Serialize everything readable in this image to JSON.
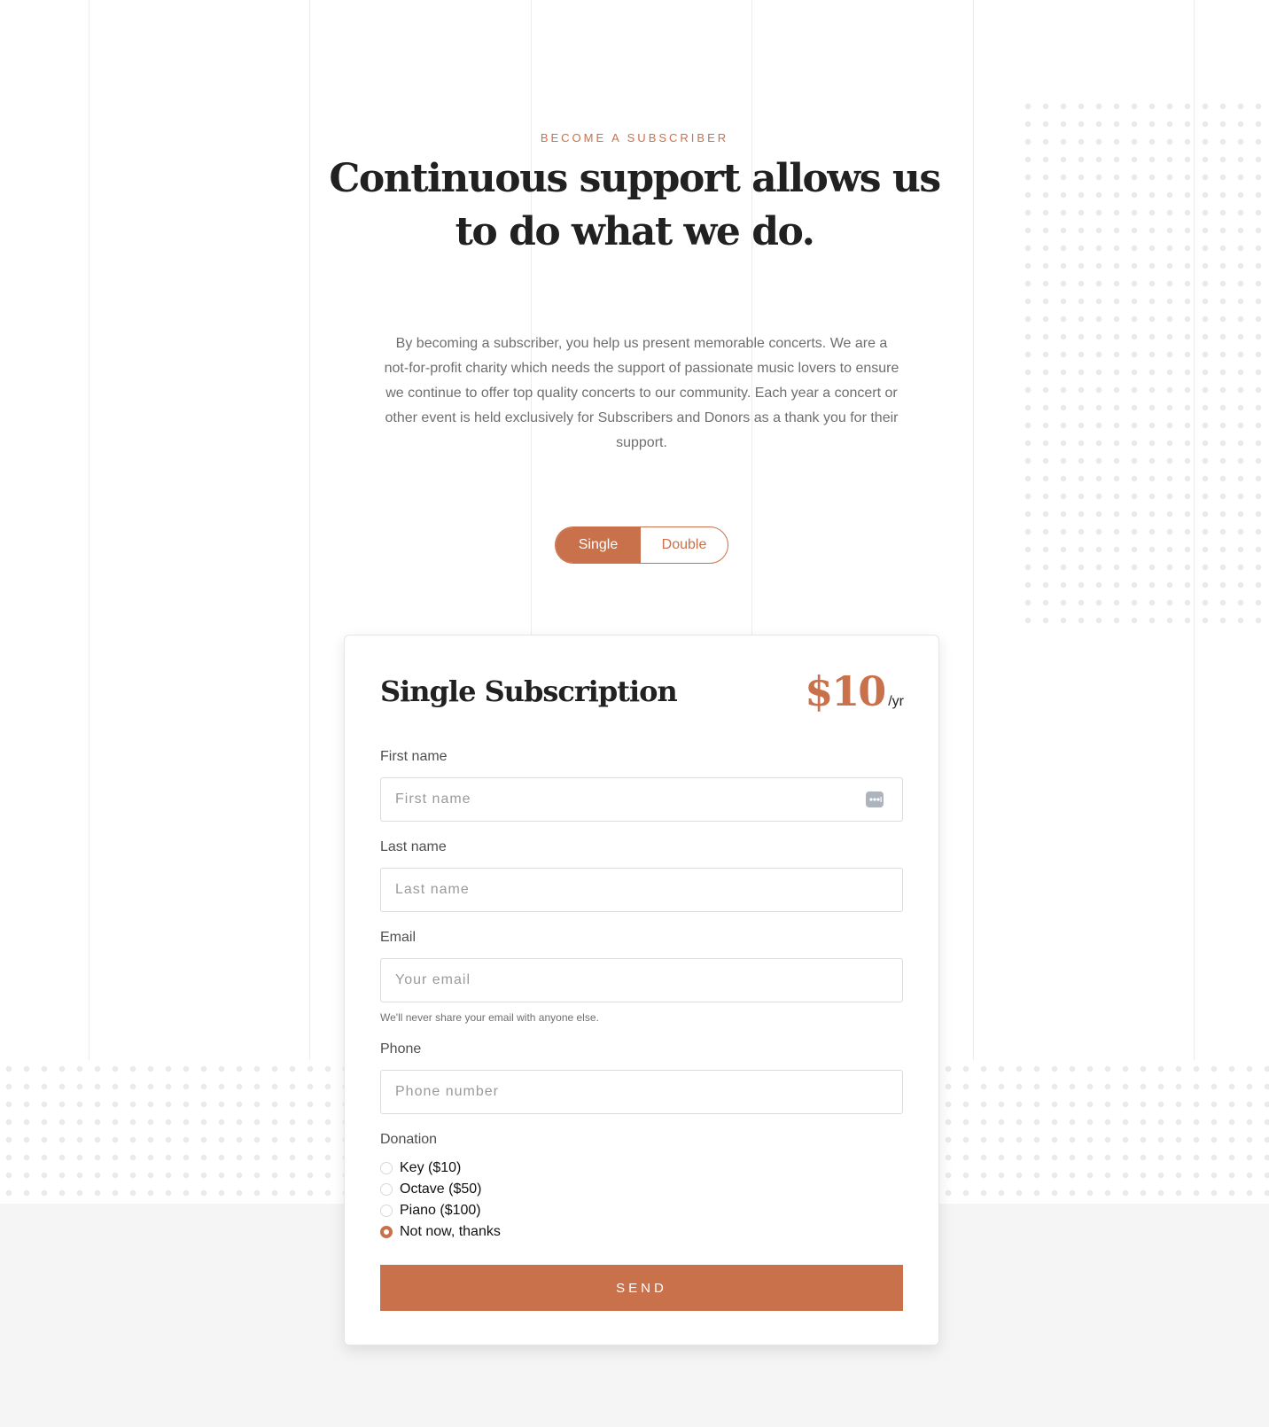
{
  "eyebrow": "BECOME A SUBSCRIBER",
  "headline": "Continuous support allows us to do what we do.",
  "intro": "By becoming a subscriber, you help us present memorable concerts. We are a not-for-profit charity which needs the support of passionate music lovers to ensure we continue to offer top quality concerts to our community. Each year a concert or other event is held exclusively for Subscribers and Donors as a thank you for their support.",
  "toggle": {
    "options": [
      "Single",
      "Double"
    ],
    "selected": "Single"
  },
  "card": {
    "title": "Single Subscription",
    "price": "$10",
    "period": "/yr"
  },
  "form": {
    "first_name": {
      "label": "First name",
      "placeholder": "First name",
      "value": ""
    },
    "last_name": {
      "label": "Last name",
      "placeholder": "Last name",
      "value": ""
    },
    "email": {
      "label": "Email",
      "placeholder": "Your email",
      "value": "",
      "help": "We'll never share your email with anyone else."
    },
    "phone": {
      "label": "Phone",
      "placeholder": "Phone number",
      "value": ""
    },
    "donation": {
      "label": "Donation",
      "options": [
        "Key ($10)",
        "Octave ($50)",
        "Piano ($100)",
        "Not now, thanks"
      ],
      "selected": "Not now, thanks"
    },
    "submit_label": "SEND"
  },
  "icons": {
    "autofill": "autofill-key-icon"
  },
  "colors": {
    "accent": "#c8714a",
    "text_dark": "#212121",
    "text_muted": "#6f6f6f",
    "band_background": "#f5f5f5"
  }
}
